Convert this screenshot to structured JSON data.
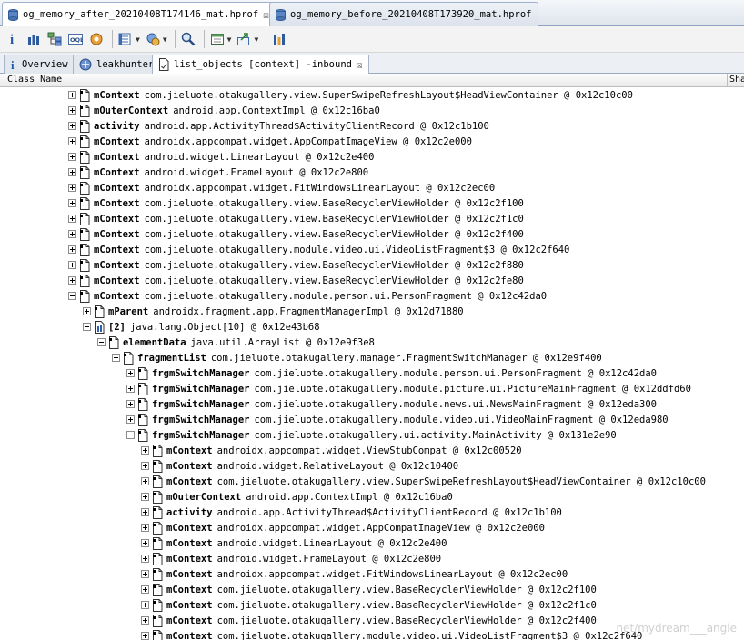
{
  "editor_tabs": [
    {
      "label": "og_memory_after_20210408T174146_mat.hprof",
      "active": true
    },
    {
      "label": "og_memory_before_20210408T173920_mat.hprof",
      "active": false
    }
  ],
  "toolbar": {
    "buttons": [
      "info-icon",
      "histogram-icon",
      "dominator-tree-icon",
      "oql-icon",
      "threads-icon",
      "query-browser-icon",
      "find-object-icon",
      "search-icon",
      "report-icon",
      "export-icon",
      "group-by-icon"
    ]
  },
  "view_tabs": [
    {
      "label": "Overview",
      "icon": "info-icon"
    },
    {
      "label": "leakhunter",
      "icon": "leak-hunter-icon"
    },
    {
      "label": "list_objects [context] -inbound",
      "icon": "list-objects-icon",
      "active": true
    }
  ],
  "columns": {
    "class_name": "Class Name",
    "shallow": "Sha"
  },
  "rows": [
    {
      "indent": 0,
      "exp": "plus",
      "field": "mContext",
      "cls": "com.jieluote.otakugallery.view.SuperSwipeRefreshLayout$HeadViewContainer @ 0x12c10c00"
    },
    {
      "indent": 0,
      "exp": "plus",
      "field": "mOuterContext",
      "cls": "android.app.ContextImpl @ 0x12c16ba0"
    },
    {
      "indent": 0,
      "exp": "plus",
      "field": "activity",
      "cls": "android.app.ActivityThread$ActivityClientRecord @ 0x12c1b100"
    },
    {
      "indent": 0,
      "exp": "plus",
      "field": "mContext",
      "cls": "androidx.appcompat.widget.AppCompatImageView @ 0x12c2e000"
    },
    {
      "indent": 0,
      "exp": "plus",
      "field": "mContext",
      "cls": "android.widget.LinearLayout @ 0x12c2e400"
    },
    {
      "indent": 0,
      "exp": "plus",
      "field": "mContext",
      "cls": "android.widget.FrameLayout @ 0x12c2e800"
    },
    {
      "indent": 0,
      "exp": "plus",
      "field": "mContext",
      "cls": "androidx.appcompat.widget.FitWindowsLinearLayout @ 0x12c2ec00"
    },
    {
      "indent": 0,
      "exp": "plus",
      "field": "mContext",
      "cls": "com.jieluote.otakugallery.view.BaseRecyclerViewHolder @ 0x12c2f100"
    },
    {
      "indent": 0,
      "exp": "plus",
      "field": "mContext",
      "cls": "com.jieluote.otakugallery.view.BaseRecyclerViewHolder @ 0x12c2f1c0"
    },
    {
      "indent": 0,
      "exp": "plus",
      "field": "mContext",
      "cls": "com.jieluote.otakugallery.view.BaseRecyclerViewHolder @ 0x12c2f400"
    },
    {
      "indent": 0,
      "exp": "plus",
      "field": "mContext",
      "cls": "com.jieluote.otakugallery.module.video.ui.VideoListFragment$3 @ 0x12c2f640"
    },
    {
      "indent": 0,
      "exp": "plus",
      "field": "mContext",
      "cls": "com.jieluote.otakugallery.view.BaseRecyclerViewHolder @ 0x12c2f880"
    },
    {
      "indent": 0,
      "exp": "plus",
      "field": "mContext",
      "cls": "com.jieluote.otakugallery.view.BaseRecyclerViewHolder @ 0x12c2fe80"
    },
    {
      "indent": 0,
      "exp": "minus",
      "field": "mContext",
      "cls": "com.jieluote.otakugallery.module.person.ui.PersonFragment @ 0x12c42da0"
    },
    {
      "indent": 1,
      "exp": "plus",
      "field": "mParent",
      "cls": "androidx.fragment.app.FragmentManagerImpl @ 0x12d71880"
    },
    {
      "indent": 1,
      "exp": "minus",
      "field": "[2]",
      "cls": "java.lang.Object[10] @ 0x12e43b68",
      "array": true
    },
    {
      "indent": 2,
      "exp": "minus",
      "field": "elementData",
      "cls": "java.util.ArrayList @ 0x12e9f3e8"
    },
    {
      "indent": 3,
      "exp": "minus",
      "field": "fragmentList",
      "cls": "com.jieluote.otakugallery.manager.FragmentSwitchManager @ 0x12e9f400"
    },
    {
      "indent": 4,
      "exp": "plus",
      "field": "frgmSwitchManager",
      "cls": "com.jieluote.otakugallery.module.person.ui.PersonFragment @ 0x12c42da0"
    },
    {
      "indent": 4,
      "exp": "plus",
      "field": "frgmSwitchManager",
      "cls": "com.jieluote.otakugallery.module.picture.ui.PictureMainFragment @ 0x12ddfd60"
    },
    {
      "indent": 4,
      "exp": "plus",
      "field": "frgmSwitchManager",
      "cls": "com.jieluote.otakugallery.module.news.ui.NewsMainFragment @ 0x12eda300"
    },
    {
      "indent": 4,
      "exp": "plus",
      "field": "frgmSwitchManager",
      "cls": "com.jieluote.otakugallery.module.video.ui.VideoMainFragment @ 0x12eda980"
    },
    {
      "indent": 4,
      "exp": "minus",
      "field": "frgmSwitchManager",
      "cls": "com.jieluote.otakugallery.ui.activity.MainActivity @ 0x131e2e90"
    },
    {
      "indent": 5,
      "exp": "plus",
      "field": "mContext",
      "cls": "androidx.appcompat.widget.ViewStubCompat @ 0x12c00520"
    },
    {
      "indent": 5,
      "exp": "plus",
      "field": "mContext",
      "cls": "android.widget.RelativeLayout @ 0x12c10400"
    },
    {
      "indent": 5,
      "exp": "plus",
      "field": "mContext",
      "cls": "com.jieluote.otakugallery.view.SuperSwipeRefreshLayout$HeadViewContainer @ 0x12c10c00"
    },
    {
      "indent": 5,
      "exp": "plus",
      "field": "mOuterContext",
      "cls": "android.app.ContextImpl @ 0x12c16ba0"
    },
    {
      "indent": 5,
      "exp": "plus",
      "field": "activity",
      "cls": "android.app.ActivityThread$ActivityClientRecord @ 0x12c1b100"
    },
    {
      "indent": 5,
      "exp": "plus",
      "field": "mContext",
      "cls": "androidx.appcompat.widget.AppCompatImageView @ 0x12c2e000"
    },
    {
      "indent": 5,
      "exp": "plus",
      "field": "mContext",
      "cls": "android.widget.LinearLayout @ 0x12c2e400"
    },
    {
      "indent": 5,
      "exp": "plus",
      "field": "mContext",
      "cls": "android.widget.FrameLayout @ 0x12c2e800"
    },
    {
      "indent": 5,
      "exp": "plus",
      "field": "mContext",
      "cls": "androidx.appcompat.widget.FitWindowsLinearLayout @ 0x12c2ec00"
    },
    {
      "indent": 5,
      "exp": "plus",
      "field": "mContext",
      "cls": "com.jieluote.otakugallery.view.BaseRecyclerViewHolder @ 0x12c2f100"
    },
    {
      "indent": 5,
      "exp": "plus",
      "field": "mContext",
      "cls": "com.jieluote.otakugallery.view.BaseRecyclerViewHolder @ 0x12c2f1c0"
    },
    {
      "indent": 5,
      "exp": "plus",
      "field": "mContext",
      "cls": "com.jieluote.otakugallery.view.BaseRecyclerViewHolder @ 0x12c2f400"
    },
    {
      "indent": 5,
      "exp": "plus",
      "field": "mContext",
      "cls": "com.jieluote.otakugallery.module.video.ui.VideoListFragment$3 @ 0x12c2f640"
    }
  ],
  "watermark": "net/mydream___angle"
}
